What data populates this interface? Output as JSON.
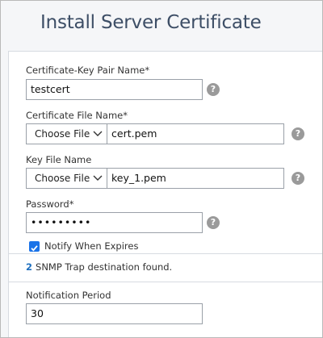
{
  "title": "Install Server Certificate",
  "form": {
    "cert_key_pair_name": {
      "label": "Certificate-Key Pair Name*",
      "value": "testcert"
    },
    "cert_file_name": {
      "label": "Certificate File Name*",
      "choose_label": "Choose File",
      "file": "cert.pem"
    },
    "key_file_name": {
      "label": "Key File Name",
      "choose_label": "Choose File",
      "file": "key_1.pem"
    },
    "password": {
      "label": "Password*",
      "value": "•••••••••"
    },
    "notify_when_expires": {
      "label": "Notify When Expires",
      "checked": true
    },
    "snmp": {
      "count": "2",
      "text": "SNMP Trap destination found."
    },
    "notification_period": {
      "label": "Notification Period",
      "value": "30"
    }
  },
  "help_symbol": "?",
  "icons": {
    "help": "help-icon",
    "chevron": "chevron-down-icon",
    "checkbox": "checkbox-checked-icon"
  },
  "colors": {
    "title": "#3d4e66",
    "checkbox": "#1a73e8",
    "snmp_count": "#1e6fbf",
    "help_icon": "#9a9a9a"
  }
}
